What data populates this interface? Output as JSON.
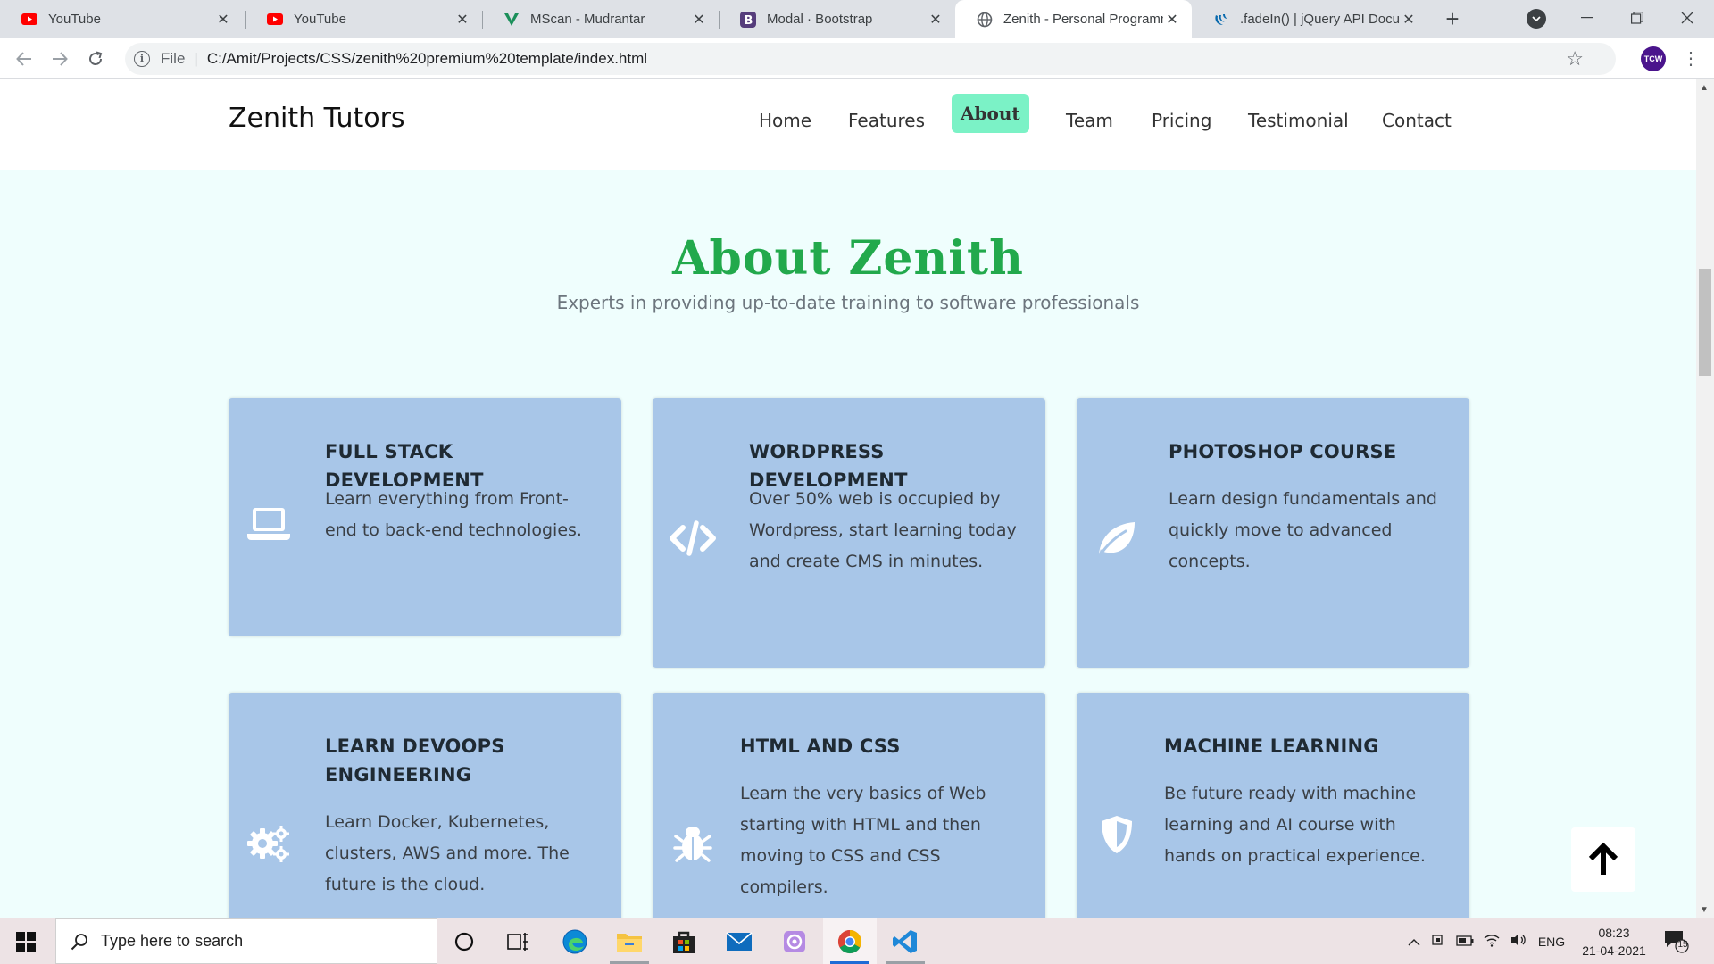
{
  "browser": {
    "tabs": [
      {
        "title": "YouTube",
        "icon": "youtube-icon"
      },
      {
        "title": "YouTube",
        "icon": "youtube-icon"
      },
      {
        "title": "MScan - Mudrantar",
        "icon": "mscan-icon"
      },
      {
        "title": "Modal · Bootstrap",
        "icon": "bootstrap-icon"
      },
      {
        "title": "Zenith - Personal Programm",
        "icon": "globe-icon"
      },
      {
        "title": ".fadeIn() | jQuery API Docum",
        "icon": "jquery-icon"
      }
    ],
    "active_tab": 4,
    "address_prefix": "File",
    "url": "C:/Amit/Projects/CSS/zenith%20premium%20template/index.html",
    "profile_initials": "TCW"
  },
  "site": {
    "brand": "Zenith Tutors",
    "nav": [
      "Home",
      "Features",
      "About",
      "Team",
      "Pricing",
      "Testimonial",
      "Contact"
    ],
    "active_nav": "About"
  },
  "about": {
    "title": "About Zenith",
    "subtitle": "Experts in providing up-to-date training to software professionals",
    "cards": [
      {
        "title": "FULL STACK DEVELOPMENT",
        "text": "Learn everything from Front-end to back-end technologies.",
        "icon": "laptop-icon"
      },
      {
        "title": "WORDPRESS DEVELOPMENT",
        "text": "Over 50% web is occupied by Wordpress, start learning today and create CMS in minutes.",
        "icon": "code-icon"
      },
      {
        "title": "PHOTOSHOP COURSE",
        "text": "Learn design fundamentals and quickly move to advanced concepts.",
        "icon": "leaf-icon"
      },
      {
        "title": "LEARN DEVOOPS ENGINEERING",
        "text": "Learn Docker, Kubernetes, clusters, AWS and more. The future is the cloud.",
        "icon": "gears-icon"
      },
      {
        "title": "HTML AND CSS",
        "text": "Learn the very basics of Web starting with HTML and then moving to CSS and CSS compilers.",
        "icon": "bug-icon"
      },
      {
        "title": "MACHINE LEARNING",
        "text": "Be future ready with machine learning and AI course with hands on practical experience.",
        "icon": "shield-icon"
      }
    ]
  },
  "taskbar": {
    "search_placeholder": "Type here to search",
    "language": "ENG",
    "time": "08:23",
    "date": "21-04-2021",
    "notification_count": "15"
  },
  "colors": {
    "accent_green": "#22a94c",
    "active_nav_bg": "#7bf2c6",
    "card_bg": "#a8c6e8",
    "page_bg": "#effefd"
  }
}
